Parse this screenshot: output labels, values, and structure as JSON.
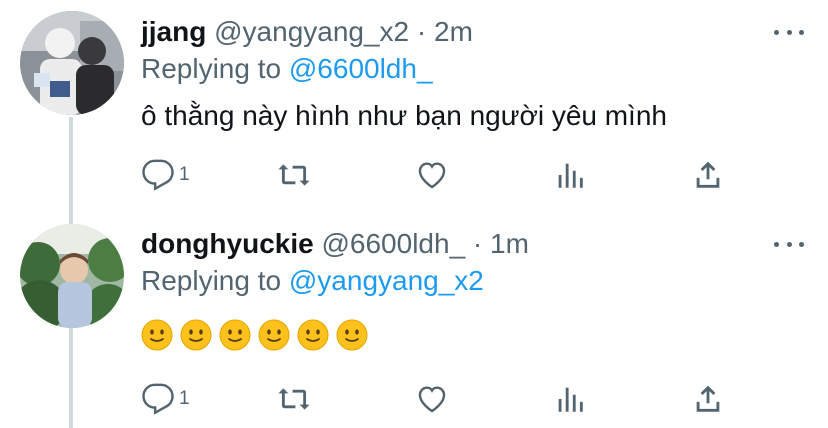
{
  "colors": {
    "text": "#0f1419",
    "secondary": "#536471",
    "accent": "#1d9bf0",
    "thread_line": "#cfd9de"
  },
  "tweets": [
    {
      "display_name": "jjang",
      "handle": "@yangyang_x2",
      "separator": "·",
      "time": "2m",
      "replying_prefix": "Replying to",
      "replying_to": "@6600ldh_",
      "text": "ô thằng này hình như bạn người yêu mình",
      "reply_count": "1",
      "icons": [
        "reply-icon",
        "retweet-icon",
        "like-icon",
        "analytics-icon",
        "share-icon"
      ]
    },
    {
      "display_name": "donghyuckie",
      "handle": "@6600ldh_",
      "separator": "·",
      "time": "1m",
      "replying_prefix": "Replying to",
      "replying_to": "@yangyang_x2",
      "emoji_count": 6,
      "emoji_name": "slightly-smiling-face-emoji",
      "reply_count": "1",
      "icons": [
        "reply-icon",
        "retweet-icon",
        "like-icon",
        "analytics-icon",
        "share-icon"
      ]
    }
  ]
}
